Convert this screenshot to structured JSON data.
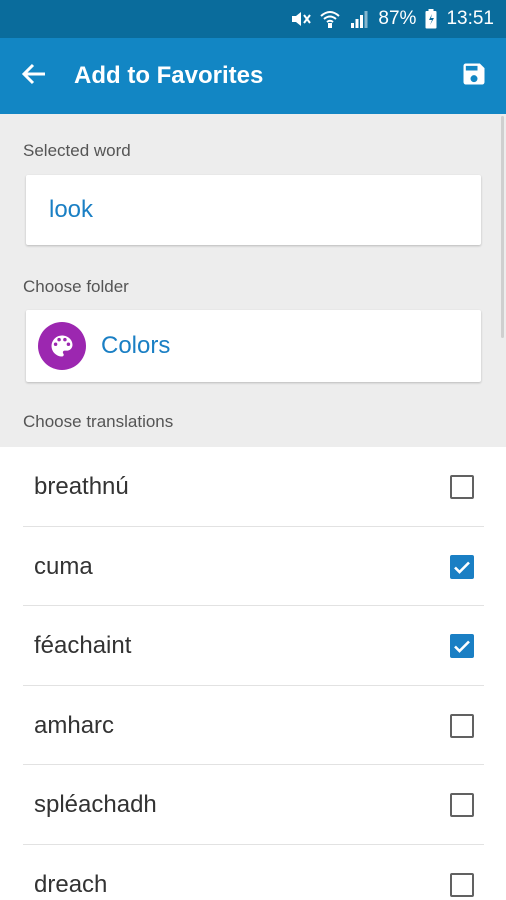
{
  "status_bar": {
    "battery": "87%",
    "time": "13:51",
    "icons": [
      "mute-icon",
      "wifi-icon",
      "signal-icon",
      "battery-icon"
    ]
  },
  "app_bar": {
    "title": "Add to Favorites",
    "back_icon": "arrow-back-icon",
    "save_icon": "save-icon"
  },
  "form": {
    "selected_word_label": "Selected word",
    "selected_word": "look",
    "choose_folder_label": "Choose folder",
    "folder": {
      "name": "Colors",
      "icon": "palette-icon",
      "color": "#9c27b0"
    },
    "choose_translations_label": "Choose translations"
  },
  "translations": [
    {
      "text": "breathnú",
      "checked": false
    },
    {
      "text": "cuma",
      "checked": true
    },
    {
      "text": "féachaint",
      "checked": true
    },
    {
      "text": "amharc",
      "checked": false
    },
    {
      "text": "spléachadh",
      "checked": false
    },
    {
      "text": "dreach",
      "checked": false
    }
  ],
  "colors": {
    "status_bar": "#0a6c9c",
    "app_bar": "#1286c4",
    "accent": "#1a7fc4",
    "form_background": "#ededed"
  }
}
